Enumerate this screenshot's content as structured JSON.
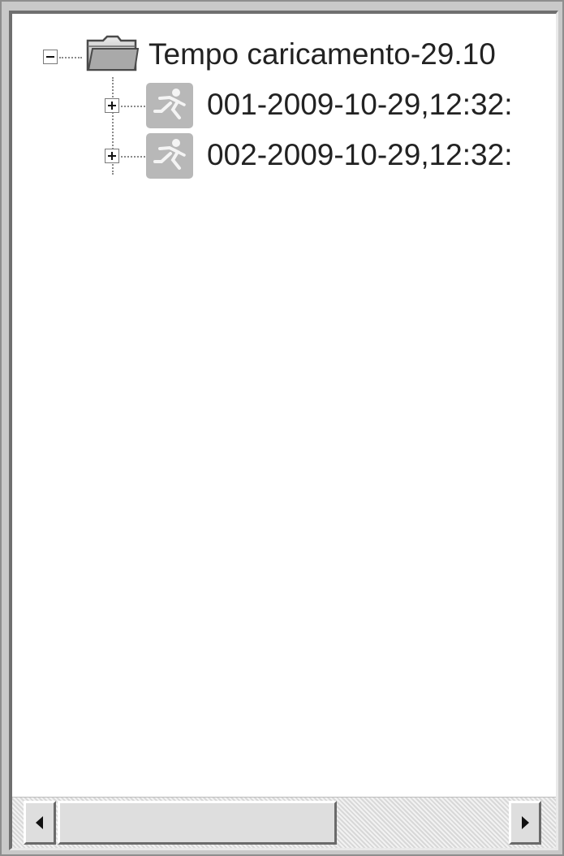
{
  "tree": {
    "root": {
      "label": "Tempo caricamento-29.10",
      "expanded": true,
      "icon": "folder-icon"
    },
    "children": [
      {
        "label": "001-2009-10-29,12:32:",
        "expanded": false,
        "icon": "running-figure-icon"
      },
      {
        "label": "002-2009-10-29,12:32:",
        "expanded": false,
        "icon": "running-figure-icon"
      }
    ]
  },
  "scrollbar": {
    "orientation": "horizontal",
    "left_arrow_icon": "arrow-left-icon",
    "right_arrow_icon": "arrow-right-icon",
    "thumb_fraction": 0.56,
    "thumb_position": 0
  },
  "colors": {
    "frame": "#c9c9c9",
    "background": "#ffffff",
    "text": "#222222",
    "node_icon": "#b8b8b8"
  }
}
